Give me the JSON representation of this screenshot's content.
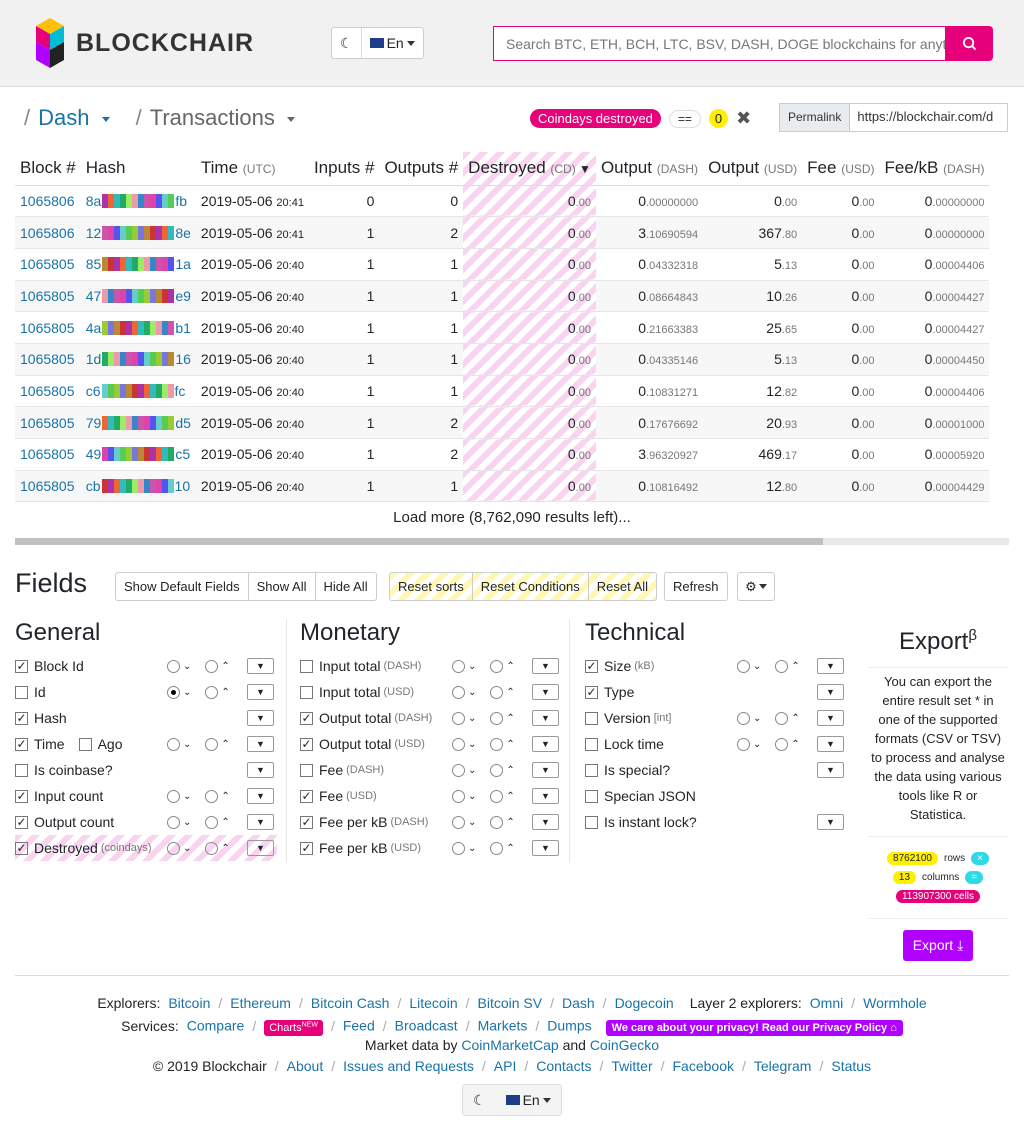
{
  "brand": {
    "name": "BLOCKCHAIR"
  },
  "header": {
    "lang": "En",
    "search_placeholder": "Search BTC, ETH, BCH, LTC, BSV, DASH, DOGE blockchains for anyth"
  },
  "crumbs": {
    "sep": "/",
    "chain": "Dash",
    "section": "Transactions"
  },
  "condition": {
    "field": "Coindays destroyed",
    "op": "==",
    "value": "0"
  },
  "permalink": {
    "label": "Permalink",
    "url": "https://blockchair.com/d"
  },
  "table": {
    "headers": [
      {
        "t": "Block #",
        "u": ""
      },
      {
        "t": "Hash",
        "u": ""
      },
      {
        "t": "Time",
        "u": "(UTC)"
      },
      {
        "t": "Inputs #",
        "u": ""
      },
      {
        "t": "Outputs #",
        "u": ""
      },
      {
        "t": "Destroyed",
        "u": "(CD)"
      },
      {
        "t": "Output",
        "u": "(DASH)"
      },
      {
        "t": "Output",
        "u": "(USD)"
      },
      {
        "t": "Fee",
        "u": "(USD)"
      },
      {
        "t": "Fee/kB",
        "u": "(DASH)"
      }
    ],
    "rows": [
      {
        "block": "1065806",
        "h1": "8a",
        "h2": "fb",
        "date": "2019-05-06",
        "time": "20:41",
        "in": "0",
        "out": "0",
        "d": "0",
        "dd": ".00",
        "o": "0",
        "od": ".00000000",
        "u": "0",
        "ud": ".00",
        "f": "0",
        "fd": ".00",
        "k": "0",
        "kd": ".00000000"
      },
      {
        "block": "1065806",
        "h1": "12",
        "h2": "8e",
        "date": "2019-05-06",
        "time": "20:41",
        "in": "1",
        "out": "2",
        "d": "0",
        "dd": ".00",
        "o": "3",
        "od": ".10690594",
        "u": "367",
        "ud": ".80",
        "f": "0",
        "fd": ".00",
        "k": "0",
        "kd": ".00000000"
      },
      {
        "block": "1065805",
        "h1": "85",
        "h2": "1a",
        "date": "2019-05-06",
        "time": "20:40",
        "in": "1",
        "out": "1",
        "d": "0",
        "dd": ".00",
        "o": "0",
        "od": ".04332318",
        "u": "5",
        "ud": ".13",
        "f": "0",
        "fd": ".00",
        "k": "0",
        "kd": ".00004406"
      },
      {
        "block": "1065805",
        "h1": "47",
        "h2": "e9",
        "date": "2019-05-06",
        "time": "20:40",
        "in": "1",
        "out": "1",
        "d": "0",
        "dd": ".00",
        "o": "0",
        "od": ".08664843",
        "u": "10",
        "ud": ".26",
        "f": "0",
        "fd": ".00",
        "k": "0",
        "kd": ".00004427"
      },
      {
        "block": "1065805",
        "h1": "4a",
        "h2": "b1",
        "date": "2019-05-06",
        "time": "20:40",
        "in": "1",
        "out": "1",
        "d": "0",
        "dd": ".00",
        "o": "0",
        "od": ".21663383",
        "u": "25",
        "ud": ".65",
        "f": "0",
        "fd": ".00",
        "k": "0",
        "kd": ".00004427"
      },
      {
        "block": "1065805",
        "h1": "1d",
        "h2": "16",
        "date": "2019-05-06",
        "time": "20:40",
        "in": "1",
        "out": "1",
        "d": "0",
        "dd": ".00",
        "o": "0",
        "od": ".04335146",
        "u": "5",
        "ud": ".13",
        "f": "0",
        "fd": ".00",
        "k": "0",
        "kd": ".00004450"
      },
      {
        "block": "1065805",
        "h1": "c6",
        "h2": "fc",
        "date": "2019-05-06",
        "time": "20:40",
        "in": "1",
        "out": "1",
        "d": "0",
        "dd": ".00",
        "o": "0",
        "od": ".10831271",
        "u": "12",
        "ud": ".82",
        "f": "0",
        "fd": ".00",
        "k": "0",
        "kd": ".00004406"
      },
      {
        "block": "1065805",
        "h1": "79",
        "h2": "d5",
        "date": "2019-05-06",
        "time": "20:40",
        "in": "1",
        "out": "2",
        "d": "0",
        "dd": ".00",
        "o": "0",
        "od": ".17676692",
        "u": "20",
        "ud": ".93",
        "f": "0",
        "fd": ".00",
        "k": "0",
        "kd": ".00001000"
      },
      {
        "block": "1065805",
        "h1": "49",
        "h2": "c5",
        "date": "2019-05-06",
        "time": "20:40",
        "in": "1",
        "out": "2",
        "d": "0",
        "dd": ".00",
        "o": "3",
        "od": ".96320927",
        "u": "469",
        "ud": ".17",
        "f": "0",
        "fd": ".00",
        "k": "0",
        "kd": ".00005920"
      },
      {
        "block": "1065805",
        "h1": "cb",
        "h2": "10",
        "date": "2019-05-06",
        "time": "20:40",
        "in": "1",
        "out": "1",
        "d": "0",
        "dd": ".00",
        "o": "0",
        "od": ".10816492",
        "u": "12",
        "ud": ".80",
        "f": "0",
        "fd": ".00",
        "k": "0",
        "kd": ".00004429"
      }
    ],
    "load_more": "Load more (8,762,090 results left)..."
  },
  "fields": {
    "title": "Fields",
    "show_default": "Show Default Fields",
    "show_all": "Show All",
    "hide_all": "Hide All",
    "reset_sorts": "Reset sorts",
    "reset_conditions": "Reset Conditions",
    "reset_all": "Reset All",
    "refresh": "Refresh"
  },
  "general": {
    "title": "General",
    "items": [
      {
        "label": "Block Id",
        "unit": "",
        "checked": true,
        "sort": true,
        "sel": false
      },
      {
        "label": "Id",
        "unit": "",
        "checked": false,
        "sort": true,
        "sel": true
      },
      {
        "label": "Hash",
        "unit": "",
        "checked": true,
        "sort": false
      },
      {
        "label": "Time",
        "unit": "",
        "checked": true,
        "sort": true,
        "extra": "Ago"
      },
      {
        "label": "Is coinbase?",
        "unit": "",
        "checked": false,
        "sort": false
      },
      {
        "label": "Input count",
        "unit": "",
        "checked": true,
        "sort": true
      },
      {
        "label": "Output count",
        "unit": "",
        "checked": true,
        "sort": true
      },
      {
        "label": "Destroyed",
        "unit": "(coindays)",
        "checked": true,
        "sort": true,
        "stripe": true
      }
    ]
  },
  "monetary": {
    "title": "Monetary",
    "items": [
      {
        "label": "Input total",
        "unit": "(DASH)",
        "checked": false,
        "sort": true
      },
      {
        "label": "Input total",
        "unit": "(USD)",
        "checked": false,
        "sort": true
      },
      {
        "label": "Output total",
        "unit": "(DASH)",
        "checked": true,
        "sort": true
      },
      {
        "label": "Output total",
        "unit": "(USD)",
        "checked": true,
        "sort": true
      },
      {
        "label": "Fee",
        "unit": "(DASH)",
        "checked": false,
        "sort": true
      },
      {
        "label": "Fee",
        "unit": "(USD)",
        "checked": true,
        "sort": true
      },
      {
        "label": "Fee per kB",
        "unit": "(DASH)",
        "checked": true,
        "sort": true
      },
      {
        "label": "Fee per kB",
        "unit": "(USD)",
        "checked": true,
        "sort": true
      }
    ]
  },
  "technical": {
    "title": "Technical",
    "items": [
      {
        "label": "Size",
        "unit": "(kB)",
        "checked": true,
        "sort": true,
        "filter": true
      },
      {
        "label": "Type",
        "unit": "",
        "checked": true,
        "sort": false,
        "filter": true
      },
      {
        "label": "Version",
        "unit": "[int]",
        "checked": false,
        "sort": true,
        "filter": true
      },
      {
        "label": "Lock time",
        "unit": "",
        "checked": false,
        "sort": true,
        "filter": true
      },
      {
        "label": "Is special?",
        "unit": "",
        "checked": false,
        "sort": false,
        "filter": true
      },
      {
        "label": "Specian JSON",
        "unit": "",
        "checked": false,
        "sort": false,
        "filter": false
      },
      {
        "label": "Is instant lock?",
        "unit": "",
        "checked": false,
        "sort": false,
        "filter": true
      }
    ]
  },
  "export": {
    "title": "Export",
    "sup": "β",
    "desc": "You can export the entire result set * in one of the supported formats (CSV or TSV) to process and analyse the data using various tools like R or Statistica.",
    "rows": "8762100",
    "rows_label": "rows",
    "cols": "13",
    "cols_label": "columns",
    "cells": "113907300 cells",
    "x": "×",
    "eq": "=",
    "button": "Export"
  },
  "footer": {
    "explorers_label": "Explorers:",
    "explorers": [
      "Bitcoin",
      "Ethereum",
      "Bitcoin Cash",
      "Litecoin",
      "Bitcoin SV",
      "Dash",
      "Dogecoin"
    ],
    "layer2_label": "Layer 2 explorers:",
    "layer2": [
      "Omni",
      "Wormhole"
    ],
    "services_label": "Services:",
    "compare": "Compare",
    "charts": "Charts",
    "charts_badge": "NEW",
    "services": [
      "Feed",
      "Broadcast",
      "Markets",
      "Dumps"
    ],
    "privacy": "We care about your privacy! Read our Privacy Policy",
    "market_prefix": "Market data by",
    "cmc": "CoinMarketCap",
    "and": "and",
    "cg": "CoinGecko",
    "copyright": "© 2019 Blockchair",
    "links": [
      "About",
      "Issues and Requests",
      "API",
      "Contacts",
      "Twitter",
      "Facebook",
      "Telegram",
      "Status"
    ],
    "lang": "En"
  },
  "colors": {
    "accent": "#e6007a",
    "link": "#1a73a8",
    "export": "#b000ff",
    "yellow": "#ffef00",
    "cyan": "#31d8e8"
  }
}
